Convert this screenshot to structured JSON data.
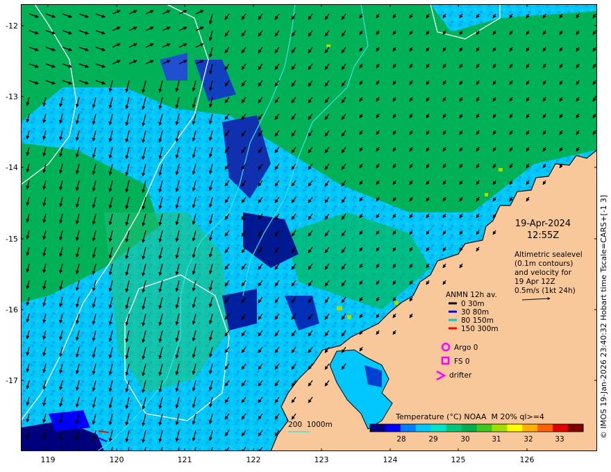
{
  "date": "19-Apr-2024",
  "time": "12:55Z",
  "altimetry": [
    "Altimetric sealevel",
    "(0.1m contours)",
    "and velocity for",
    "19 Apr 12Z",
    "0.5m/s (1kt 24h)"
  ],
  "anmn": {
    "title": "ANMN 12h av.",
    "items": [
      {
        "label": "0 30m",
        "color": "#000000"
      },
      {
        "label": "30 80m",
        "color": "#0000ff"
      },
      {
        "label": "80 150m",
        "color": "#00cccc"
      },
      {
        "label": "150 300m",
        "color": "#ff0000"
      }
    ]
  },
  "markers": [
    {
      "label": "Argo 0",
      "symbol": "circle",
      "color": "#ff00ff"
    },
    {
      "label": "FS 0",
      "symbol": "square",
      "color": "#ff00ff"
    },
    {
      "label": "drifter",
      "symbol": "chevron",
      "color": "#ff00ff"
    }
  ],
  "isobath_label": "200  1000m",
  "colorbar": {
    "title": "Temperature (°C) NOAA  M 20% ql>=4",
    "ticks": [
      "28",
      "29",
      "30",
      "31",
      "32",
      "33"
    ],
    "colors": [
      "#00007f",
      "#0000ff",
      "#0080ff",
      "#00c8ff",
      "#00e5c8",
      "#00c87a",
      "#00b050",
      "#40c820",
      "#a0e000",
      "#ffff00",
      "#ffb000",
      "#ff6000",
      "#e00000",
      "#800000"
    ]
  },
  "side_text": "© IMOS 19-Jan-2026 23:40:32 Hobart time Tscale=CARS+[-1 3]",
  "lat_ticks": [
    "-12",
    "-13",
    "-14",
    "-15",
    "-16",
    "-17"
  ],
  "lon_ticks": [
    "119",
    "120",
    "121",
    "122",
    "123",
    "124",
    "125",
    "126"
  ],
  "colors": {
    "land": "#f9c89a",
    "sst_main": "#00c8ff",
    "sst_warm": "#00b050",
    "sst_cold": "#00007f"
  }
}
